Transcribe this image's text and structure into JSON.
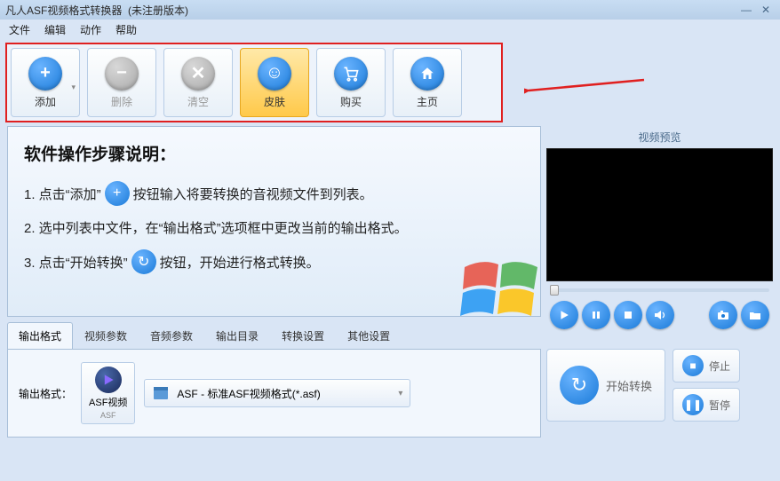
{
  "window": {
    "title": "凡人ASF视频格式转换器",
    "subtitle": "(未注册版本)"
  },
  "menu": [
    "文件",
    "编辑",
    "动作",
    "帮助"
  ],
  "toolbar": [
    {
      "label": "添加",
      "icon": "plus",
      "state": "normal"
    },
    {
      "label": "删除",
      "icon": "minus",
      "state": "disabled"
    },
    {
      "label": "清空",
      "icon": "x",
      "state": "disabled"
    },
    {
      "label": "皮肤",
      "icon": "smile",
      "state": "selected"
    },
    {
      "label": "购买",
      "icon": "cart",
      "state": "normal"
    },
    {
      "label": "主页",
      "icon": "home",
      "state": "normal"
    }
  ],
  "guide": {
    "title": "软件操作步骤说明：",
    "step1a": "1. 点击“添加”",
    "step1b": "按钮输入将要转换的音视频文件到列表。",
    "step2": "2. 选中列表中文件，在“输出格式”选项框中更改当前的输出格式。",
    "step3a": "3. 点击“开始转换”",
    "step3b": "按钮，开始进行格式转换。"
  },
  "tabs": [
    "输出格式",
    "视频参数",
    "音频参数",
    "输出目录",
    "转换设置",
    "其他设置"
  ],
  "format": {
    "label": "输出格式：",
    "btn_label": "ASF视频",
    "btn_sub": "ASF",
    "select_text": "ASF - 标准ASF视频格式(*.asf)"
  },
  "preview": {
    "title": "视频预览"
  },
  "actions": {
    "start": "开始转换",
    "stop": "停止",
    "pause": "暂停"
  }
}
